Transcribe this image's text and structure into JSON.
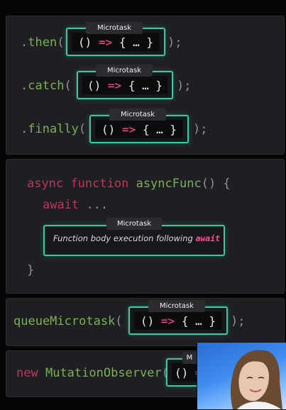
{
  "panel1": {
    "lines": [
      {
        "dot": ".",
        "method": "then",
        "open": "(",
        "close": ");"
      },
      {
        "dot": ".",
        "method": "catch",
        "open": "(",
        "close": ");"
      },
      {
        "dot": ".",
        "method": "finally",
        "open": "(",
        "close": ");"
      }
    ]
  },
  "microtask_label": "Microtask",
  "arrow_fn": {
    "paren": "()",
    "arrow": "=>",
    "body": "{ … }"
  },
  "panel2": {
    "kw_async": "async",
    "kw_function": "function",
    "fn_name": "asyncFunc",
    "sig_rest": "() {",
    "kw_await": "await",
    "await_rest": "...",
    "note_prefix": "Function body execution following",
    "note_keyword": "await",
    "close_brace": "}"
  },
  "panel3": {
    "fn": "queueMicrotask",
    "open": "(",
    "close": ");"
  },
  "panel4": {
    "kw_new": "new",
    "cls": "MutationObserver",
    "open": "("
  },
  "webcam": {
    "description_icon": "person-icon"
  }
}
